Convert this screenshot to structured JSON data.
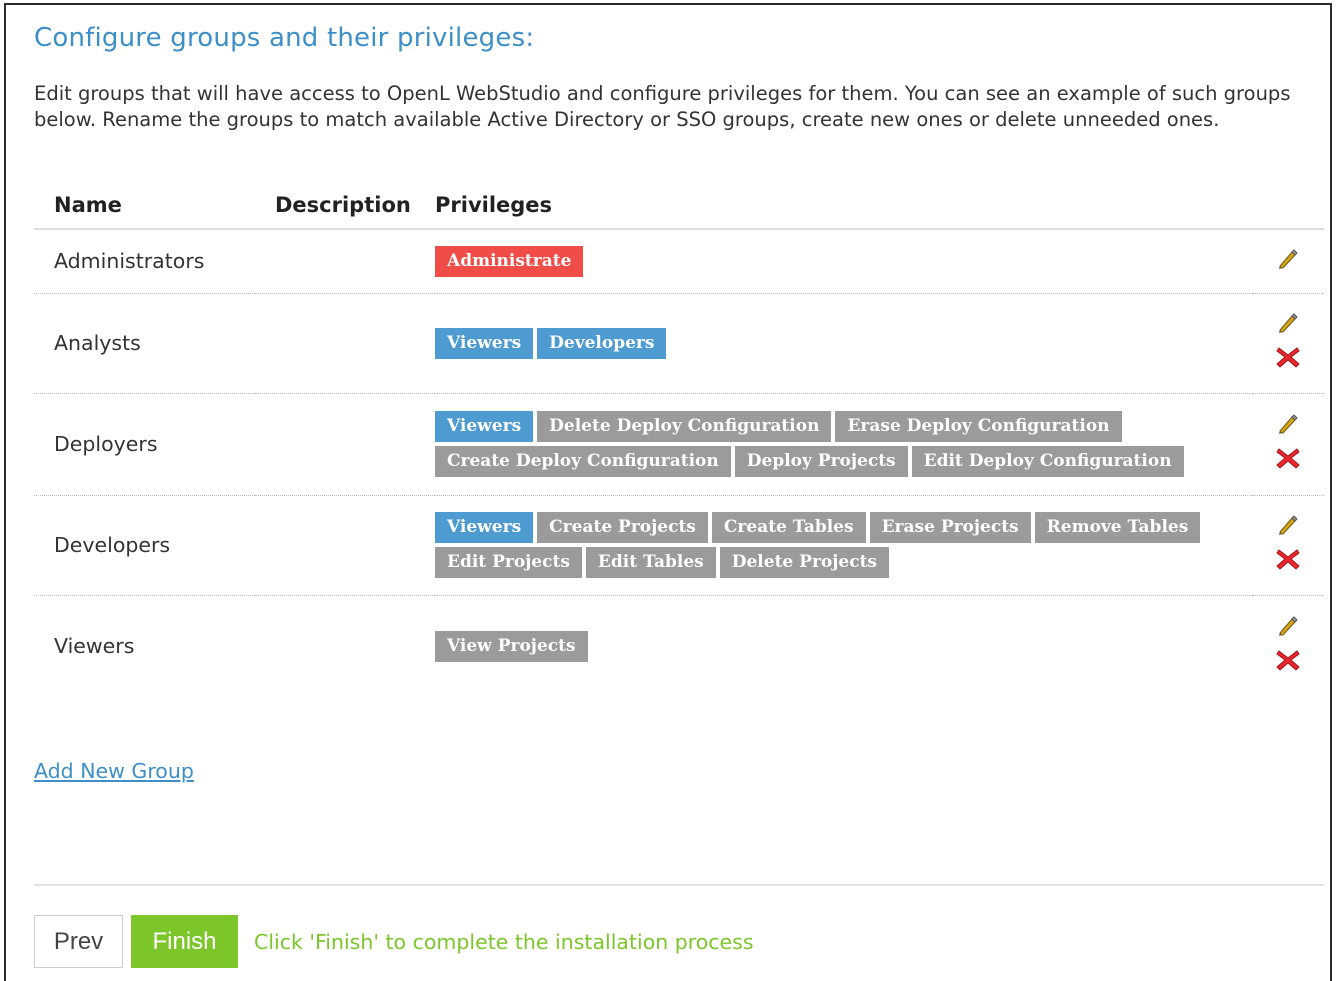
{
  "page": {
    "title": "Configure groups and their privileges:",
    "intro": "Edit groups that will have access to OpenL WebStudio and configure privileges for them. You can see an example of such groups below. Rename the groups to match available Active Directory or SSO groups, create new ones or delete unneeded ones."
  },
  "table": {
    "headers": {
      "name": "Name",
      "description": "Description",
      "privileges": "Privileges"
    },
    "rows": [
      {
        "name": "Administrators",
        "description": "",
        "deletable": false,
        "privileges": [
          {
            "label": "Administrate",
            "kind": "admin"
          }
        ]
      },
      {
        "name": "Analysts",
        "description": "",
        "deletable": true,
        "privileges": [
          {
            "label": "Viewers",
            "kind": "group"
          },
          {
            "label": "Developers",
            "kind": "group"
          }
        ]
      },
      {
        "name": "Deployers",
        "description": "",
        "deletable": true,
        "privileges": [
          {
            "label": "Viewers",
            "kind": "group"
          },
          {
            "label": "Delete Deploy Configuration",
            "kind": "privilege"
          },
          {
            "label": "Erase Deploy Configuration",
            "kind": "privilege"
          },
          {
            "label": "Create Deploy Configuration",
            "kind": "privilege"
          },
          {
            "label": "Deploy Projects",
            "kind": "privilege"
          },
          {
            "label": "Edit Deploy Configuration",
            "kind": "privilege"
          }
        ]
      },
      {
        "name": "Developers",
        "description": "",
        "deletable": true,
        "privileges": [
          {
            "label": "Viewers",
            "kind": "group"
          },
          {
            "label": "Create Projects",
            "kind": "privilege"
          },
          {
            "label": "Create Tables",
            "kind": "privilege"
          },
          {
            "label": "Erase Projects",
            "kind": "privilege"
          },
          {
            "label": "Remove Tables",
            "kind": "privilege"
          },
          {
            "label": "Edit Projects",
            "kind": "privilege"
          },
          {
            "label": "Edit Tables",
            "kind": "privilege"
          },
          {
            "label": "Delete Projects",
            "kind": "privilege"
          }
        ]
      },
      {
        "name": "Viewers",
        "description": "",
        "deletable": true,
        "privileges": [
          {
            "label": "View Projects",
            "kind": "privilege"
          }
        ]
      }
    ]
  },
  "actions": {
    "edit_icon": "pencil-icon",
    "delete_icon": "delete-icon"
  },
  "links": {
    "add_group": "Add New Group"
  },
  "footer": {
    "prev_label": "Prev",
    "finish_label": "Finish",
    "hint": "Click 'Finish' to complete the installation process"
  },
  "colors": {
    "title": "#3d8fc7",
    "admin_badge": "#f04c48",
    "group_badge": "#4d9bd1",
    "privilege_badge": "#9b9b9b",
    "finish_button": "#7cc62a",
    "delete_icon": "#e8262d"
  }
}
